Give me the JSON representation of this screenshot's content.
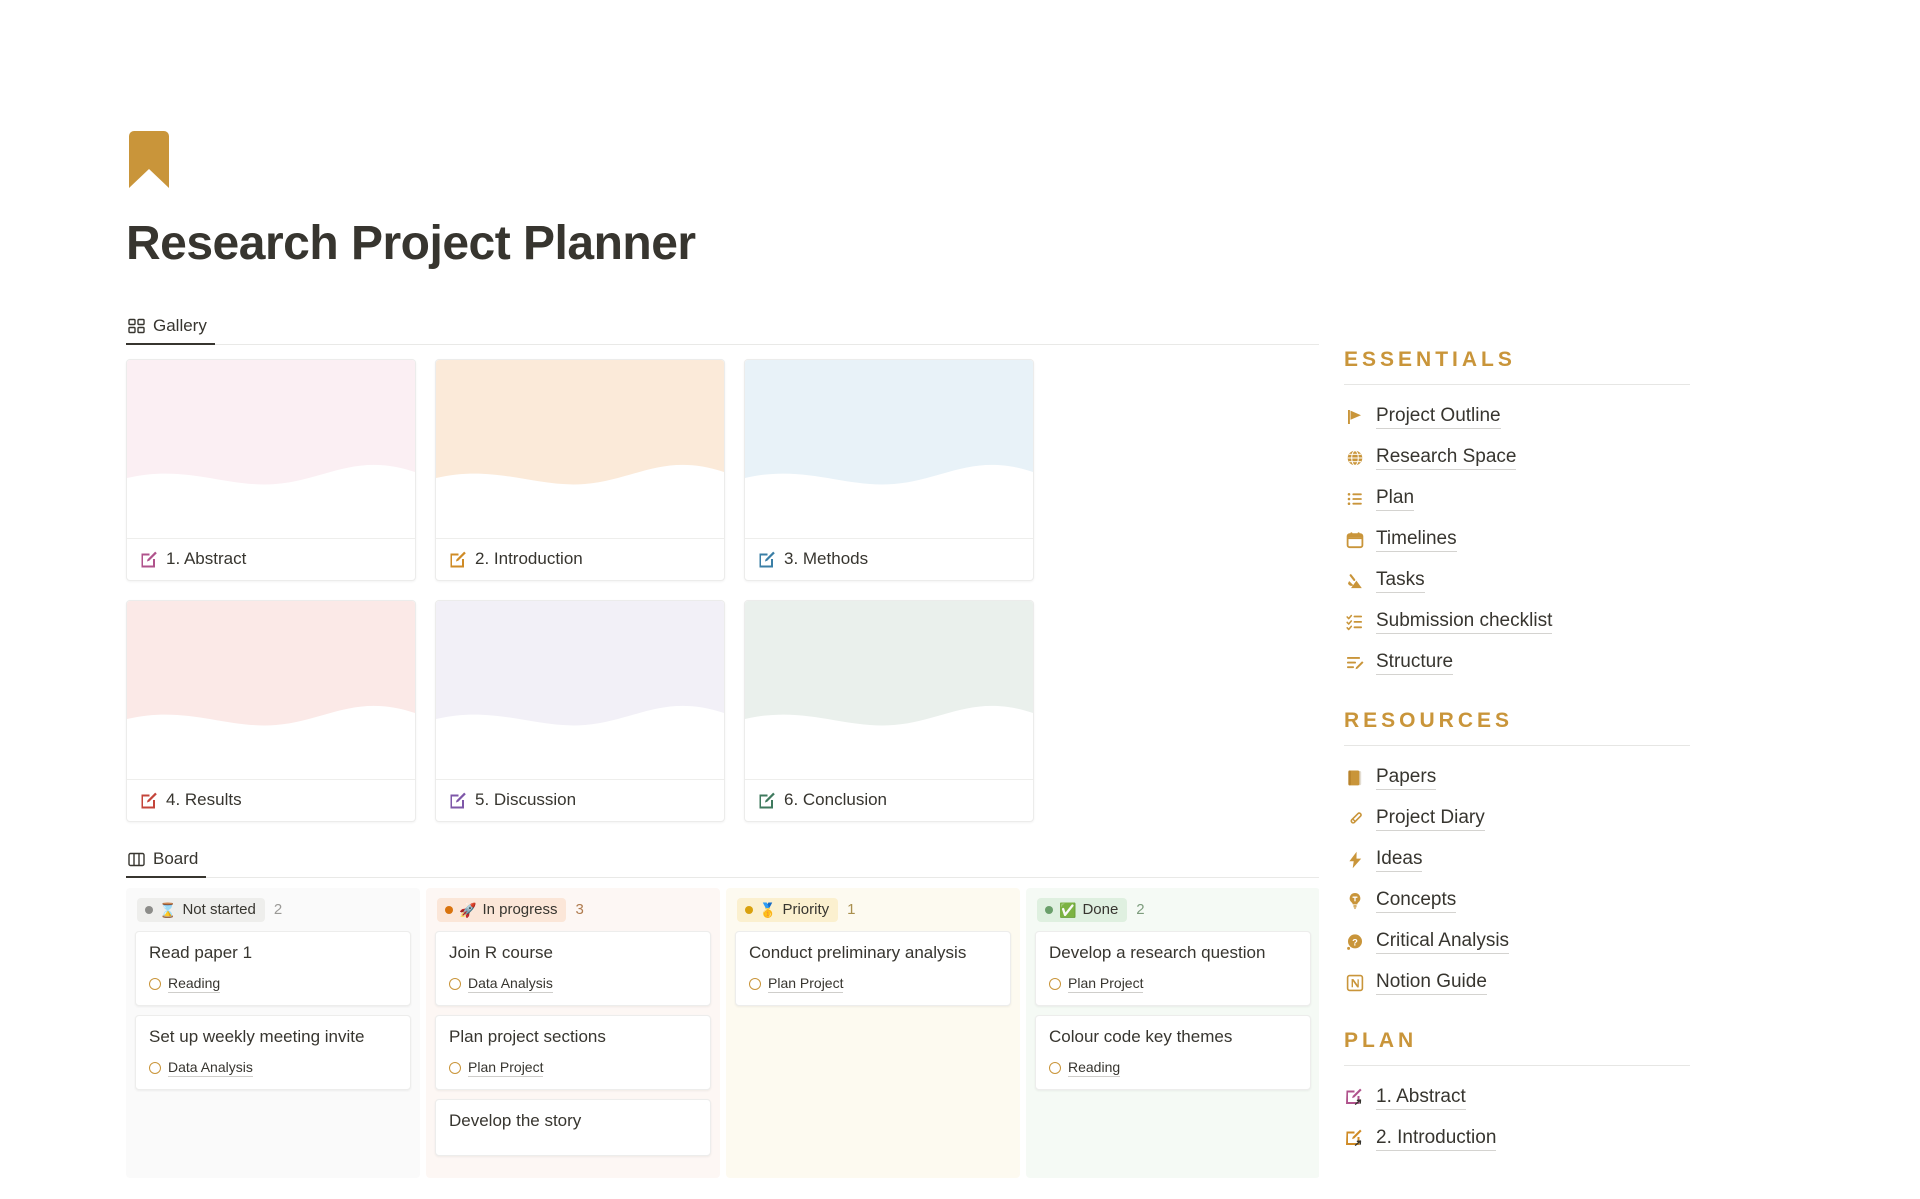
{
  "header": {
    "icon": "bookmark-icon",
    "icon_color": "#c9953a",
    "title": "Research Project Planner"
  },
  "gallery_view": {
    "tab_label": "Gallery",
    "tab_icon": "gallery-grid-icon",
    "cards": [
      {
        "title": "1. Abstract",
        "cover_color": "#fbeff3",
        "icon_color": "#b0538c",
        "icon": "edit-document-icon"
      },
      {
        "title": "2. Introduction",
        "cover_color": "#fbead9",
        "icon_color": "#cf8b26",
        "icon": "edit-document-icon"
      },
      {
        "title": "3. Methods",
        "cover_color": "#e8f2f8",
        "icon_color": "#3b7fa6",
        "icon": "edit-document-icon"
      },
      {
        "title": "4. Results",
        "cover_color": "#fbe9e7",
        "icon_color": "#c4453b",
        "icon": "edit-document-icon"
      },
      {
        "title": "5. Discussion",
        "cover_color": "#f2f0f7",
        "icon_color": "#7e57a8",
        "icon": "edit-document-icon"
      },
      {
        "title": "6. Conclusion",
        "cover_color": "#eaf0ec",
        "icon_color": "#3f7a5e",
        "icon": "edit-document-icon"
      }
    ]
  },
  "board_view": {
    "tab_label": "Board",
    "tab_icon": "board-columns-icon",
    "columns": [
      {
        "name": "Not started",
        "emoji": "⌛",
        "count": "2",
        "dot_color": "#8c8c89",
        "chip_bg": "#eeeeec",
        "chip_text": "#37352f",
        "column_bg": "#fafafa",
        "count_color": "#9b9a97",
        "cards": [
          {
            "title": "Read paper 1",
            "tag": "Reading"
          },
          {
            "title": "Set up weekly meeting invite",
            "tag": "Data Analysis"
          }
        ]
      },
      {
        "name": "In progress",
        "emoji": "🚀",
        "count": "3",
        "dot_color": "#d9730d",
        "chip_bg": "#fbe6d8",
        "chip_text": "#37352f",
        "column_bg": "#fdf7f4",
        "count_color": "#b07c4f",
        "cards": [
          {
            "title": "Join R course",
            "tag": "Data Analysis"
          },
          {
            "title": "Plan project sections",
            "tag": "Plan Project"
          },
          {
            "title": "Develop the story",
            "tag": ""
          }
        ]
      },
      {
        "name": "Priority",
        "emoji": "🥇",
        "count": "1",
        "dot_color": "#d9a10d",
        "chip_bg": "#fbf0cf",
        "chip_text": "#37352f",
        "column_bg": "#fdfaf0",
        "count_color": "#a98f4e",
        "cards": [
          {
            "title": "Conduct preliminary analysis",
            "tag": "Plan Project"
          }
        ]
      },
      {
        "name": "Done",
        "emoji": "✅",
        "count": "2",
        "dot_color": "#6a9f6a",
        "chip_bg": "#dff0e0",
        "chip_text": "#37352f",
        "column_bg": "#f5faf5",
        "count_color": "#7d9c7d",
        "cards": [
          {
            "title": "Develop a research question",
            "tag": "Plan Project"
          },
          {
            "title": "Colour code key themes",
            "tag": "Reading"
          }
        ]
      }
    ]
  },
  "sidebar": {
    "accent_color": "#c9953a",
    "sections": [
      {
        "heading": "ESSENTIALS",
        "items": [
          {
            "label": "Project Outline",
            "icon": "flag-icon"
          },
          {
            "label": "Research Space",
            "icon": "globe-icon"
          },
          {
            "label": "Plan",
            "icon": "bullet-list-icon"
          },
          {
            "label": "Timelines",
            "icon": "calendar-icon"
          },
          {
            "label": "Tasks",
            "icon": "tools-icon"
          },
          {
            "label": "Submission checklist",
            "icon": "checklist-icon"
          },
          {
            "label": "Structure",
            "icon": "edit-list-icon"
          }
        ]
      },
      {
        "heading": "RESOURCES",
        "items": [
          {
            "label": "Papers",
            "icon": "book-icon"
          },
          {
            "label": "Project Diary",
            "icon": "pencil-icon"
          },
          {
            "label": "Ideas",
            "icon": "lightning-icon"
          },
          {
            "label": "Concepts",
            "icon": "lightbulb-icon"
          },
          {
            "label": "Critical Analysis",
            "icon": "question-bubble-icon"
          },
          {
            "label": "Notion Guide",
            "icon": "notion-logo-icon"
          }
        ]
      },
      {
        "heading": "PLAN",
        "items": [
          {
            "label": "1. Abstract",
            "icon": "edit-document-link-icon",
            "icon_color": "#b0538c"
          },
          {
            "label": "2. Introduction",
            "icon": "edit-document-link-icon",
            "icon_color": "#cf8b26"
          }
        ]
      }
    ]
  }
}
